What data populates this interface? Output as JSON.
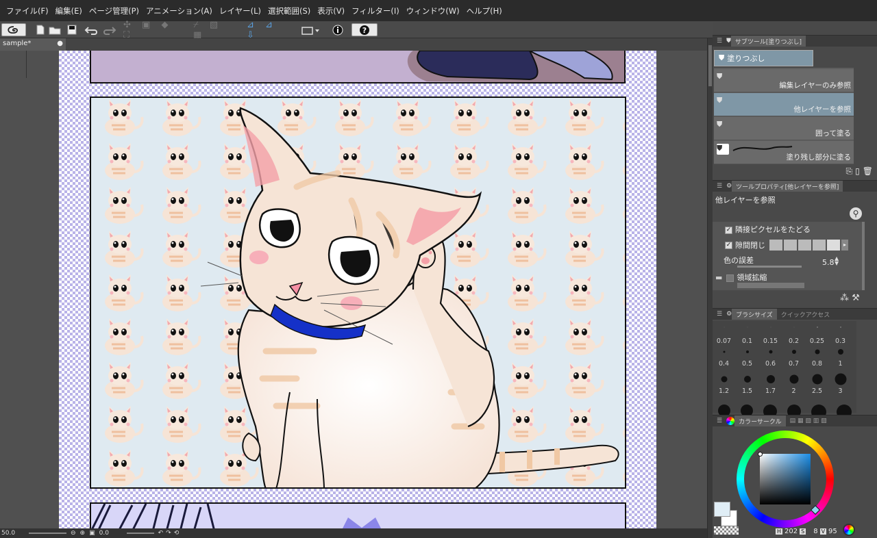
{
  "menu": [
    "ファイル(F)",
    "編集(E)",
    "ページ管理(P)",
    "アニメーション(A)",
    "レイヤー(L)",
    "選択範囲(S)",
    "表示(V)",
    "フィルター(I)",
    "ウィンドウ(W)",
    "ヘルプ(H)"
  ],
  "tab": {
    "name": "sample*"
  },
  "status": {
    "zoom": "50.0",
    "angle": "0.0"
  },
  "subtool": {
    "header": "サブツール[塗りつぶし]",
    "group": "塗りつぶし",
    "items": [
      "編集レイヤーのみ参照",
      "他レイヤーを参照",
      "囲って塗る",
      "塗り残し部分に塗る"
    ],
    "selected_index": 1
  },
  "toolprop": {
    "header": "ツールプロパティ[他レイヤーを参照]",
    "title": "他レイヤーを参照",
    "follow_adjacent": "隣接ピクセルをたどる",
    "close_gap": "隙間閉じ",
    "color_margin_label": "色の誤差",
    "color_margin_value": "5.8",
    "area_scaling": "領域拡縮"
  },
  "brushsize": {
    "tab_active": "ブラシサイズ",
    "tab_inactive": "クイックアクセス",
    "sizes": [
      "0.07",
      "0.1",
      "0.15",
      "0.2",
      "0.25",
      "0.3",
      "0.4",
      "0.5",
      "0.6",
      "0.7",
      "0.8",
      "1",
      "1.2",
      "1.5",
      "1.7",
      "2",
      "2.5",
      "3"
    ]
  },
  "color": {
    "tab": "カラーサークル",
    "h": "202",
    "h_label": "H",
    "s": "8",
    "s_label": "S",
    "v": "95",
    "v_label": "V",
    "main_color": "#e0eef6",
    "sub_color": "#ffffff"
  },
  "icons": [
    "logo-icon",
    "new-file-icon",
    "open-icon",
    "save-icon",
    "undo-icon",
    "redo-icon",
    "transform-icon",
    "fill-icon",
    "info-icon",
    "help-icon",
    "bucket-icon",
    "wrench-icon",
    "trash-icon",
    "zoom-icon"
  ]
}
